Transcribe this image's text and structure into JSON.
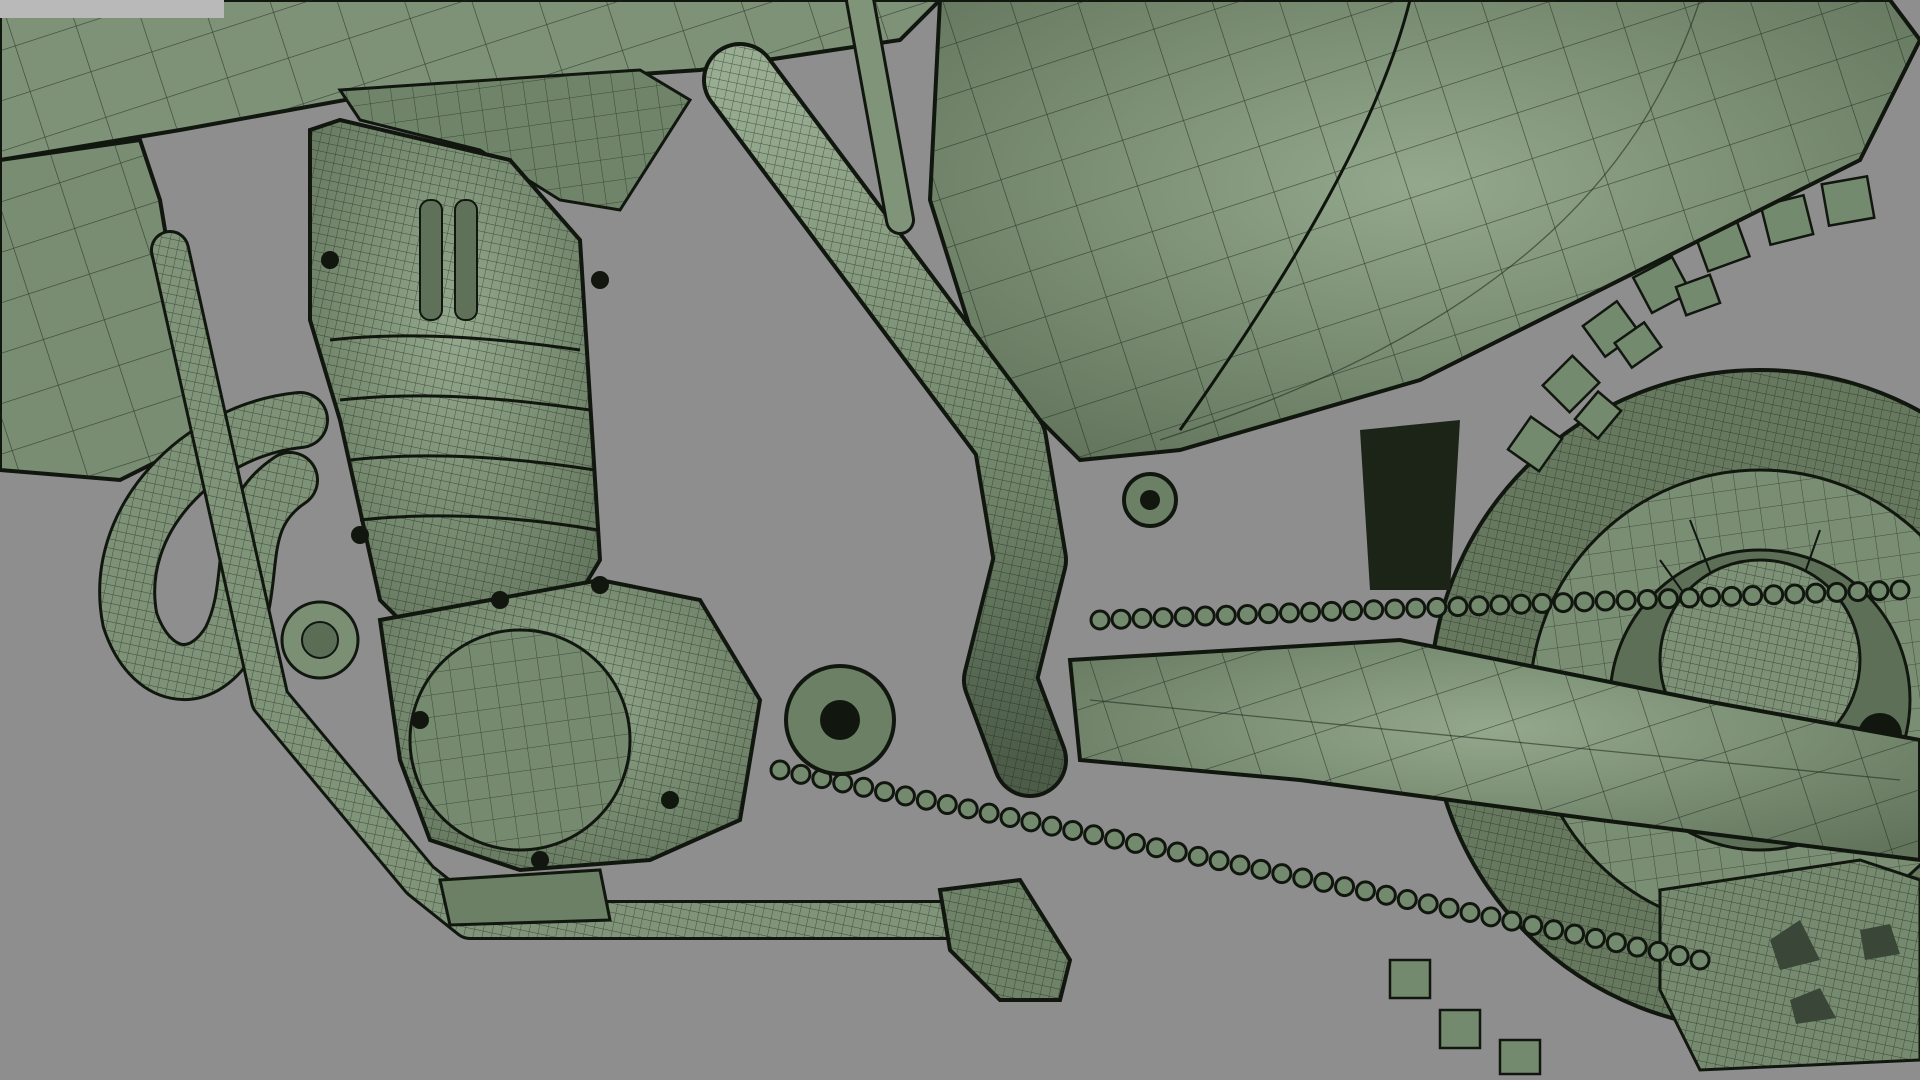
{
  "viewport": {
    "background": "#8e8e8e",
    "model_color": "#7f9479",
    "wire_color": "#1c2418",
    "shade_color": "#5c6e57",
    "tab_color": "#b9b9b9"
  },
  "scene": {
    "subject": "motorcycle-wireframe-model"
  }
}
